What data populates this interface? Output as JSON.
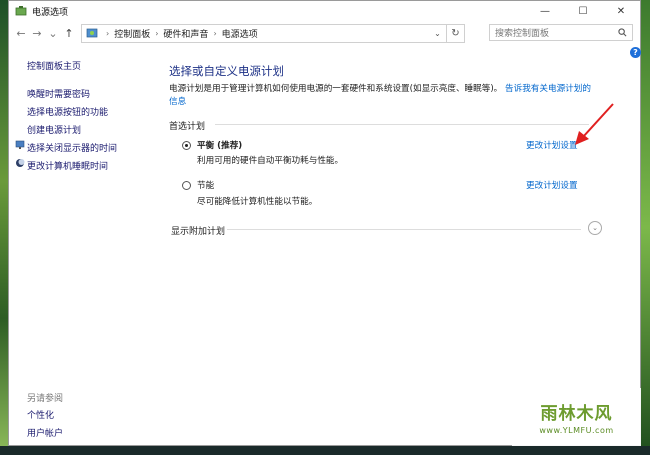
{
  "window": {
    "title": "电源选项",
    "controls": {
      "minimize": "—",
      "maximize": "☐",
      "close": "✕"
    }
  },
  "nav": {
    "back": "←",
    "forward": "→",
    "dropdown": "⌄",
    "up": "↑",
    "breadcrumb": [
      "控制面板",
      "硬件和声音",
      "电源选项"
    ],
    "search_placeholder": "搜索控制面板"
  },
  "sidebar": {
    "home": "控制面板主页",
    "links": [
      {
        "label": "唤醒时需要密码",
        "icon": null
      },
      {
        "label": "选择电源按钮的功能",
        "icon": null
      },
      {
        "label": "创建电源计划",
        "icon": null
      },
      {
        "label": "选择关闭显示器的时间",
        "icon": "monitor-icon"
      },
      {
        "label": "更改计算机睡眠时间",
        "icon": "moon-icon"
      }
    ],
    "see_also": "另请参阅",
    "see_also_links": [
      "个性化",
      "用户帐户"
    ]
  },
  "main": {
    "heading": "选择或自定义电源计划",
    "description": "电源计划是用于管理计算机如何使用电源的一套硬件和系统设置(如显示亮度、睡眠等)。",
    "description_link": "告诉我有关电源计划的信息",
    "preferred_label": "首选计划",
    "plans": [
      {
        "name": "平衡 (推荐)",
        "desc": "利用可用的硬件自动平衡功耗与性能。",
        "link": "更改计划设置",
        "selected": true
      },
      {
        "name": "节能",
        "desc": "尽可能降低计算机性能以节能。",
        "link": "更改计划设置",
        "selected": false
      }
    ],
    "show_additional": "显示附加计划"
  },
  "watermark": {
    "main": "雨林木风",
    "sub": "www.YLMFU.com"
  },
  "colors": {
    "link": "#0066cc",
    "heading": "#1e3287",
    "accent": "#1e6fd9"
  }
}
